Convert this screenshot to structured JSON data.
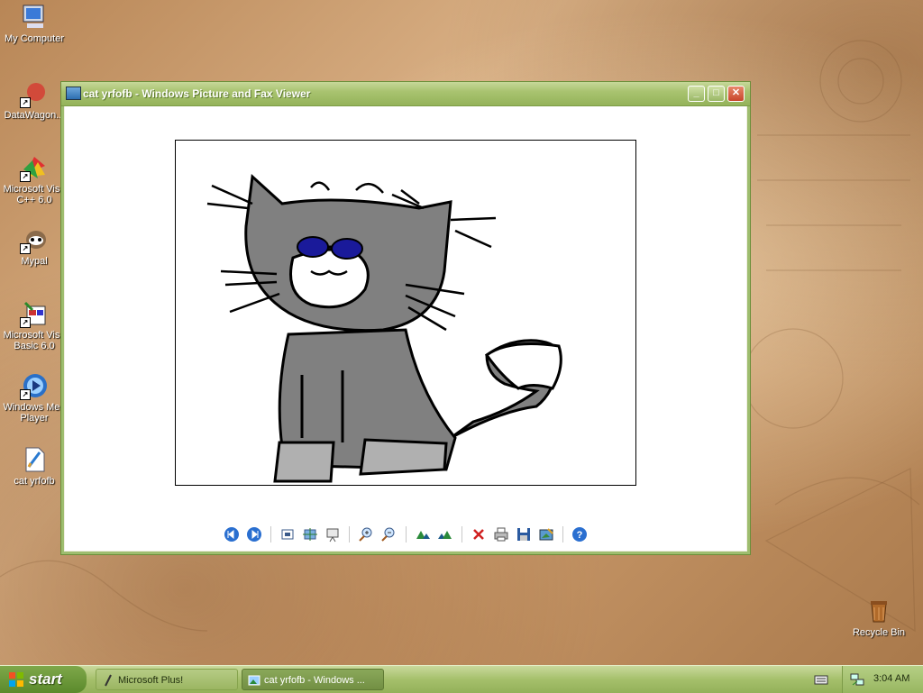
{
  "desktop": {
    "icons": [
      {
        "label": "My Computer",
        "icon": "my-computer-icon"
      },
      {
        "label": "DataWagon...",
        "icon": "datawagon-icon"
      },
      {
        "label": "Microsoft Visu\nC++ 6.0",
        "icon": "visual-cpp-icon"
      },
      {
        "label": "Mypal",
        "icon": "mypal-icon"
      },
      {
        "label": "Microsoft Visu\nBasic 6.0",
        "icon": "visual-basic-icon"
      },
      {
        "label": "Windows Med\nPlayer",
        "icon": "media-player-icon"
      },
      {
        "label": "cat yrfofb",
        "icon": "paint-file-icon"
      }
    ],
    "recycle_bin": {
      "label": "Recycle Bin",
      "icon": "recycle-bin-icon"
    }
  },
  "window": {
    "title": "cat yrfofb - Windows Picture and Fax Viewer",
    "accent": "#94b35a",
    "close_color": "#c8452b",
    "toolbar": [
      "previous-image-icon",
      "next-image-icon",
      "best-fit-icon",
      "actual-size-icon",
      "slideshow-icon",
      "zoom-in-icon",
      "zoom-out-icon",
      "rotate-clockwise-icon",
      "rotate-counterclockwise-icon",
      "delete-icon",
      "print-icon",
      "save-icon",
      "edit-icon",
      "help-icon"
    ]
  },
  "taskbar": {
    "start_label": "start",
    "tasks": [
      {
        "label": "Microsoft Plus!",
        "icon": "plus-icon"
      },
      {
        "label": "cat yrfofb - Windows ...",
        "icon": "picture-viewer-icon"
      }
    ],
    "clock": "3:04 AM"
  }
}
